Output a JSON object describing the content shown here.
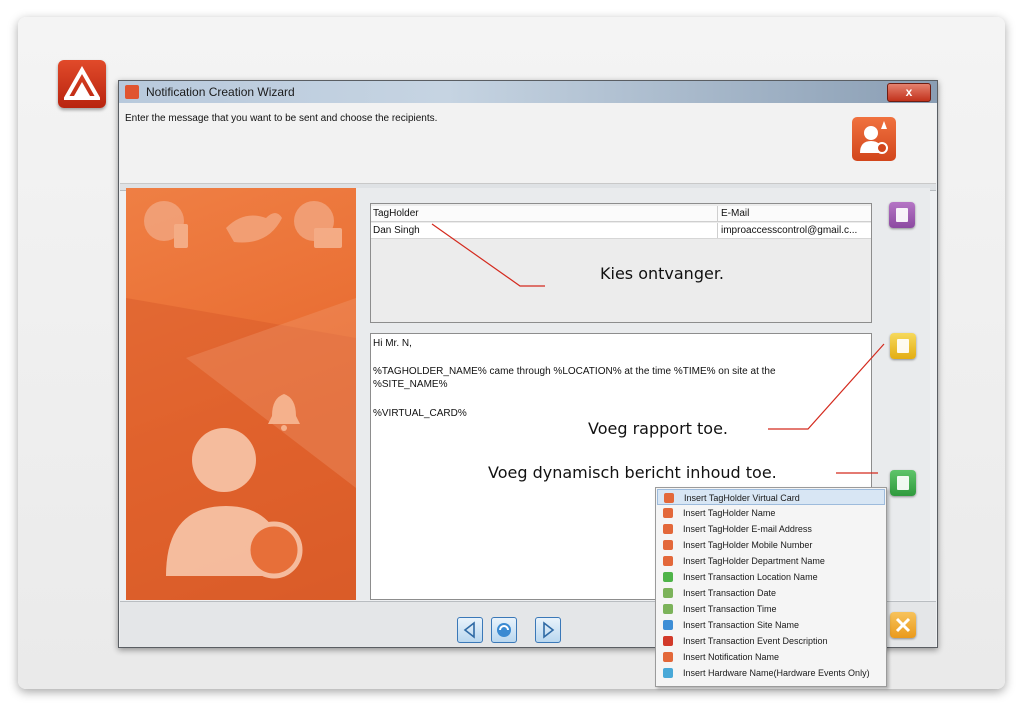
{
  "window": {
    "title": "Notification Creation Wizard",
    "close_label": "x",
    "instruction": "Enter the message that you want to be sent and choose the recipients."
  },
  "recipients": {
    "columns": [
      "TagHolder",
      "E-Mail"
    ],
    "rows": [
      [
        "Dan Singh",
        "improaccesscontrol@gmail.c..."
      ]
    ]
  },
  "message": {
    "lines": [
      "Hi Mr. N,",
      "%TAGHOLDER_NAME% came through %LOCATION% at the time %TIME% on site at the",
      "%SITE_NAME%",
      "%VIRTUAL_CARD%"
    ]
  },
  "annotations": {
    "choose_recipient": "Kies ontvanger.",
    "add_report": "Voeg rapport toe.",
    "add_dynamic": "Voeg dynamisch bericht inhoud toe."
  },
  "menu": {
    "items": [
      {
        "label": "Insert TagHolder Virtual Card",
        "color": "#e3683a"
      },
      {
        "label": "Insert TagHolder Name",
        "color": "#e3683a"
      },
      {
        "label": "Insert TagHolder E-mail Address",
        "color": "#e3683a"
      },
      {
        "label": "Insert TagHolder Mobile Number",
        "color": "#e3683a"
      },
      {
        "label": "Insert TagHolder Department Name",
        "color": "#e3683a"
      },
      {
        "label": "Insert Transaction Location Name",
        "color": "#4fb449"
      },
      {
        "label": "Insert Transaction Date",
        "color": "#7cb35a"
      },
      {
        "label": "Insert Transaction Time",
        "color": "#7cb35a"
      },
      {
        "label": "Insert Transaction Site Name",
        "color": "#3e8ed6"
      },
      {
        "label": "Insert Transaction Event Description",
        "color": "#d23a2a"
      },
      {
        "label": "Insert Notification Name",
        "color": "#e3683a"
      },
      {
        "label": "Insert Hardware Name(Hardware Events Only)",
        "color": "#49a9d8"
      }
    ],
    "highlighted_index": 0
  },
  "colors": {
    "accent_orange": "#e86a2f",
    "annotation_line": "#d42a1e"
  }
}
